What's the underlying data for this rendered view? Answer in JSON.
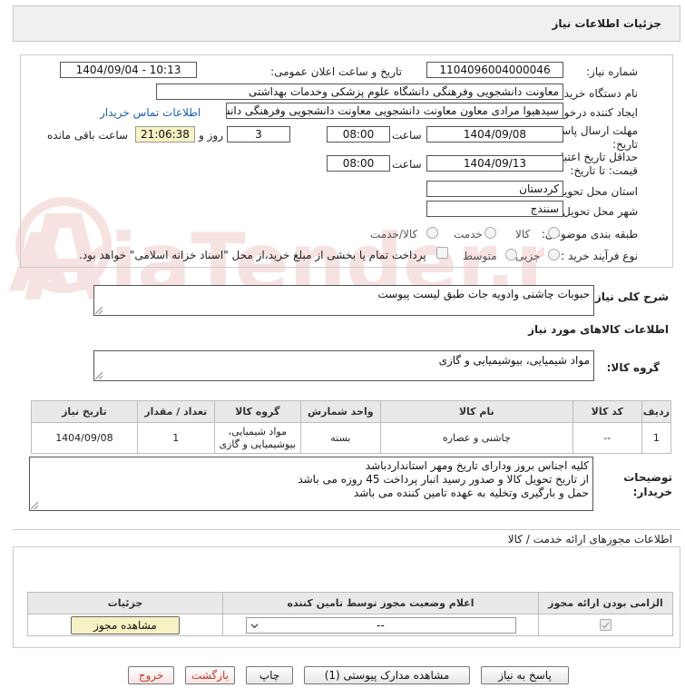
{
  "panel": {
    "title": "جزئیات اطلاعات نیاز"
  },
  "fields": {
    "need_number_label": "شماره نیاز:",
    "need_number": "1104096004000046",
    "announce_label": "تاریخ و ساعت اعلان عمومی:",
    "announce_value": "1404/09/04 - 10:13",
    "buyer_org_label": "نام دستگاه خریدار:",
    "buyer_org": "معاونت دانشجویی وفرهنگی دانشگاه علوم پزشکی وخدمات بهداشتی",
    "requester_label": "ایجاد کننده درخواست:",
    "requester": "سیدهیوا مرادی معاون معاونت دانشجویی معاونت دانشجویی وفرهنگی دانشگاه علوم پز",
    "contact_link": "اطلاعات تماس خریدار",
    "deadline_label_1": "مهلت ارسال پاسخ: تا",
    "deadline_label_2": "تاریخ:",
    "deadline_date": "1404/09/08",
    "time_label": "ساعت",
    "deadline_time": "08:00",
    "days_value": "3",
    "days_and": "روز و",
    "remaining_time": "21:06:38",
    "remaining_label": "ساعت باقی مانده",
    "validity_label_1": "حداقل تاریخ اعتبار",
    "validity_label_2": "قیمت: تا تاریخ:",
    "validity_date": "1404/09/13",
    "validity_time": "08:00",
    "province_label": "استان محل تحویل:",
    "province": "کردستان",
    "city_label": "شهر محل تحویل:",
    "city": "سنندج",
    "category_label": "طبقه بندی موضوعی:",
    "category_options": [
      "کالا",
      "خدمت",
      "کالا/خدمت"
    ],
    "process_label": "نوع فرآیند خرید :",
    "process_options": [
      "جزیی",
      "متوسط"
    ],
    "payment_note": "پرداخت تمام یا بخشی از مبلغ خرید،از محل \"اسناد خزانه اسلامی\" خواهد بود."
  },
  "summary": {
    "label": "شرح کلی نیاز:",
    "text": "حبوبات چاشنی وادویه جات طبق لیست پیوست"
  },
  "goods": {
    "section_title": "اطلاعات کالاهای مورد نیاز",
    "group_label": "گروه کالا:",
    "group_value": "مواد شیمیایی، بیوشیمیایی و  گازی",
    "table": {
      "headers": [
        "ردیف",
        "کد کالا",
        "نام کالا",
        "واحد شمارش",
        "گروه کالا",
        "تعداد / مقدار",
        "تاریخ نیاز"
      ],
      "rows": [
        [
          "1",
          "--",
          "چاشنی و عصاره",
          "بسته",
          "مواد شیمیایی، بیوشیمیایی و گازی",
          "1",
          "1404/09/08"
        ]
      ]
    }
  },
  "buyer_notes": {
    "label_1": "توضیحات",
    "label_2": "خریدار:",
    "lines": [
      "کلیه اجناس بروز ودارای تاریخ ومهر استانداردباشد",
      "از تاریخ تحویل کالا و صدور رسید انبار پرداخت 45 روزه می باشد",
      "حمل و بارگیری وتخلیه به عهده تامین کننده می باشد"
    ]
  },
  "permits": {
    "section_title": "اطلاعات مجوزهای ارائه خدمت / کالا",
    "headers": [
      "الزامی بودن ارائه مجوز",
      "اعلام وضعیت مجوز توسط تامین کننده",
      "جزئیات"
    ],
    "select_value": "--",
    "view_button": "مشاهده مجوز"
  },
  "footer_buttons": {
    "respond": "پاسخ به نیاز",
    "attachments": "مشاهده مدارک پیوستی (1)",
    "print": "چاپ",
    "back": "بازگشت",
    "exit": "خروج"
  },
  "watermark": {
    "text": "AriaTender.neT"
  },
  "colors": {
    "link": "#1a5fb4",
    "remaining_bg": "#f7f2c4",
    "exit_text": "#c0392b",
    "back_text": "#c0392b"
  }
}
